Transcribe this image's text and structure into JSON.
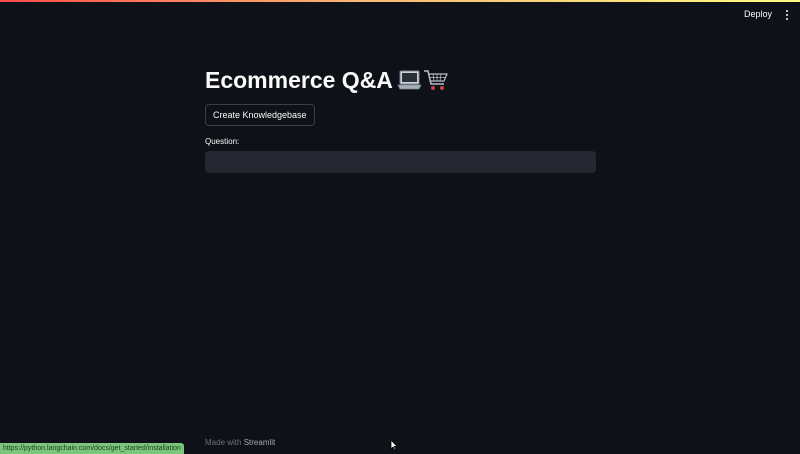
{
  "header": {
    "deploy_label": "Deploy",
    "menu_icon": "kebab-menu-icon"
  },
  "main": {
    "title": "Ecommerce Q&A",
    "title_icons": [
      "laptop-icon",
      "shopping-cart-icon"
    ],
    "create_button_label": "Create Knowledgebase",
    "question_label": "Question:",
    "question_value": "",
    "question_placeholder": ""
  },
  "footer": {
    "made_with": "Made with",
    "brand": "Streamlit"
  },
  "statusbar": {
    "url": "https://python.langchain.com/docs/get_started/installation"
  },
  "colors": {
    "background": "#0e1117",
    "input_background": "#262730",
    "status_green": "#7ac67a"
  }
}
